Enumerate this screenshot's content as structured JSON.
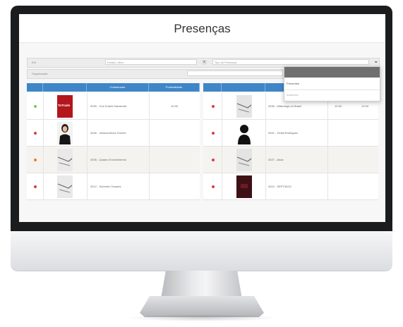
{
  "page": {
    "title": "Presenças"
  },
  "filters": {
    "label_1": "Edi",
    "input_1": "Estado: Ativo",
    "clear_1": "x",
    "select_1": "Tipo de Presença",
    "label_2": "Organização"
  },
  "dropdown": {
    "option_1": "Presentes",
    "option_2": "Ausentes"
  },
  "left_table": {
    "headers": [
      "",
      "",
      "Colaborador",
      "Pontualidade",
      ""
    ],
    "rows": [
      {
        "status_color": "#7cc95c",
        "name": "9030 - Cris Duarte Navarrete",
        "time": "10:30",
        "thumb": "logo",
        "logo_text": "ToTrade"
      },
      {
        "status_color": "#e23b3b",
        "name": "3046 - Jéssica Alves Gomes",
        "time": "",
        "thumb": "woman"
      },
      {
        "status_color": "#f07a2a",
        "name": "3035 - Quadro Envolvimento",
        "time": "",
        "thumb": "placeholder"
      },
      {
        "status_color": "#e23b3b",
        "name": "3012 - Sobrinho Tavares",
        "time": "",
        "thumb": "placeholder"
      }
    ]
  },
  "right_table": {
    "headers": [
      "",
      "",
      "Colaborador",
      "",
      ""
    ],
    "rows": [
      {
        "status_color": "#e23b3b",
        "name": "3035 - Alfândega do Brasil",
        "time": "10:30",
        "time2": "12:00",
        "thumb": "placeholder"
      },
      {
        "status_color": "#e23b3b",
        "name": "3041 - Giulia Rodrigues",
        "time": "",
        "thumb": "silhouette"
      },
      {
        "status_color": "#e23b3b",
        "name": "3027 - Atual",
        "time": "",
        "thumb": "placeholder"
      },
      {
        "status_color": "#e23b3b",
        "name": "3010 - SEPTIAGO",
        "time": "",
        "thumb": "photo-dark"
      }
    ]
  }
}
